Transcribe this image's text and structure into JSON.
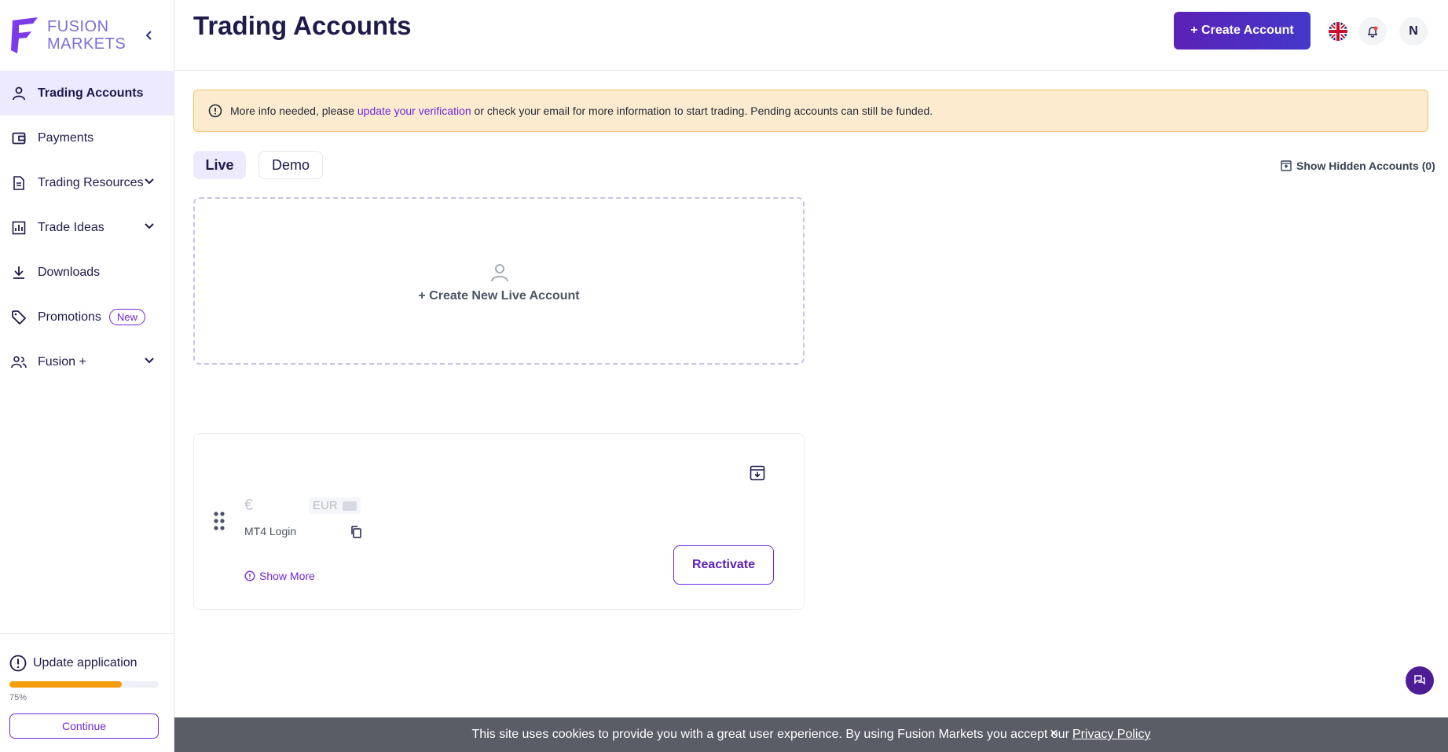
{
  "brand": {
    "line1": "FUSION",
    "line2": "MARKETS",
    "color": "#7c6fd6"
  },
  "sidebar": {
    "items": [
      {
        "label": "Trading Accounts",
        "icon": "person-icon",
        "active": true
      },
      {
        "label": "Payments",
        "icon": "wallet-icon"
      },
      {
        "label": "Trading Resources",
        "icon": "document-icon",
        "expandable": true
      },
      {
        "label": "Trade Ideas",
        "icon": "bar-chart-icon",
        "expandable": true
      },
      {
        "label": "Downloads",
        "icon": "download-icon"
      },
      {
        "label": "Promotions",
        "icon": "tag-icon",
        "badge": "New"
      },
      {
        "label": "Fusion +",
        "icon": "users-icon",
        "expandable": true
      }
    ],
    "update": {
      "label": "Update application",
      "progress_percent": 75,
      "progress_text": "75%",
      "continue_label": "Continue"
    }
  },
  "header": {
    "title": "Trading Accounts",
    "create_label": "+ Create Account",
    "avatar_initial": "N"
  },
  "alert": {
    "prefix": "More info needed, please ",
    "link": "update your verification",
    "suffix": " or check your email for more information to start trading. Pending accounts can still be funded."
  },
  "tabs": {
    "live": "Live",
    "demo": "Demo"
  },
  "show_hidden": "Show Hidden Accounts (0)",
  "new_account": {
    "label": "+ Create New Live Account"
  },
  "account": {
    "currency_symbol": "€",
    "currency": "EUR",
    "login_label": "MT4 Login",
    "show_more": "Show More",
    "reactivate": "Reactivate"
  },
  "cookie": {
    "text": "This site uses cookies to provide you with a great user experience. By using Fusion Markets you accept our",
    "link": "Privacy Policy",
    "close": "×"
  },
  "colors": {
    "accent": "#6d28d9",
    "alert_bg": "#fdebd0",
    "progress": "#f59e0b"
  }
}
